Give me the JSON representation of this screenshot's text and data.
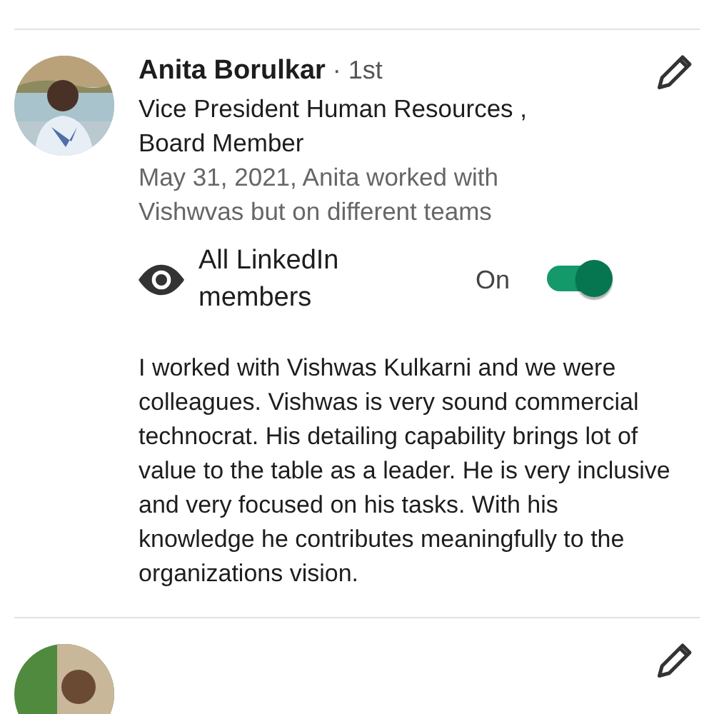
{
  "recommendations": [
    {
      "name": "Anita Borulkar",
      "degree": "· 1st",
      "headline": "Vice President Human Resources , Board Member",
      "relation": "May 31, 2021, Anita worked with Vishwvas but on different teams",
      "visibility": {
        "label": "All LinkedIn members",
        "state_text": "On",
        "on": true
      },
      "text": "I worked with Vishwas Kulkarni and we were colleagues.  Vishwas is very sound commercial technocrat. His detailing capability brings lot of value to the table as a leader. He is very inclusive and very focused on his tasks. With his knowledge he contributes meaningfully to the organizations vision."
    },
    {
      "kind": "picture"
    }
  ]
}
